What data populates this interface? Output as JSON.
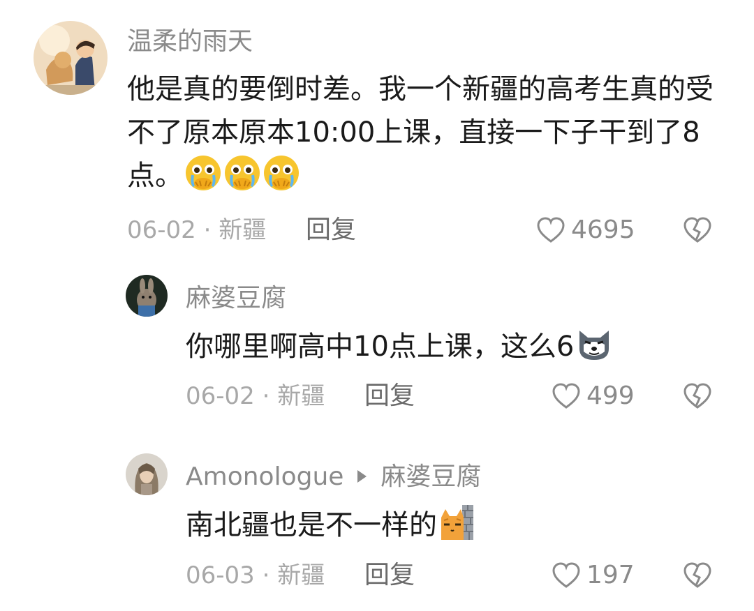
{
  "comments": [
    {
      "username": "温柔的雨天",
      "text": "他是真的要倒时差。我一个新疆的高考生真的受不了原本原本10:00上课，直接一下子干到了8点。",
      "emoji": "crying-hands-emoji",
      "meta": "06-02 · 新疆",
      "reply_label": "回复",
      "likes": "4695"
    },
    {
      "username": "麻婆豆腐",
      "text": "你哪里啊高中10点上课，这么6",
      "emoji": "wolf-emoji",
      "meta": "06-02 · 新疆",
      "reply_label": "回复",
      "likes": "499"
    },
    {
      "username": "Amonologue",
      "reply_to": "麻婆豆腐",
      "text": "南北疆也是不一样的",
      "emoji": "peeking-cat-emoji",
      "meta": "06-03 · 新疆",
      "reply_label": "回复",
      "likes": "197"
    }
  ],
  "icons": {
    "like": "heart-outline-icon",
    "dislike": "broken-heart-icon"
  },
  "colors": {
    "text": "#1a1a1a",
    "username": "#8a8a8a",
    "meta": "#a8a8a8",
    "emoji_yellow": "#f7c52e"
  }
}
